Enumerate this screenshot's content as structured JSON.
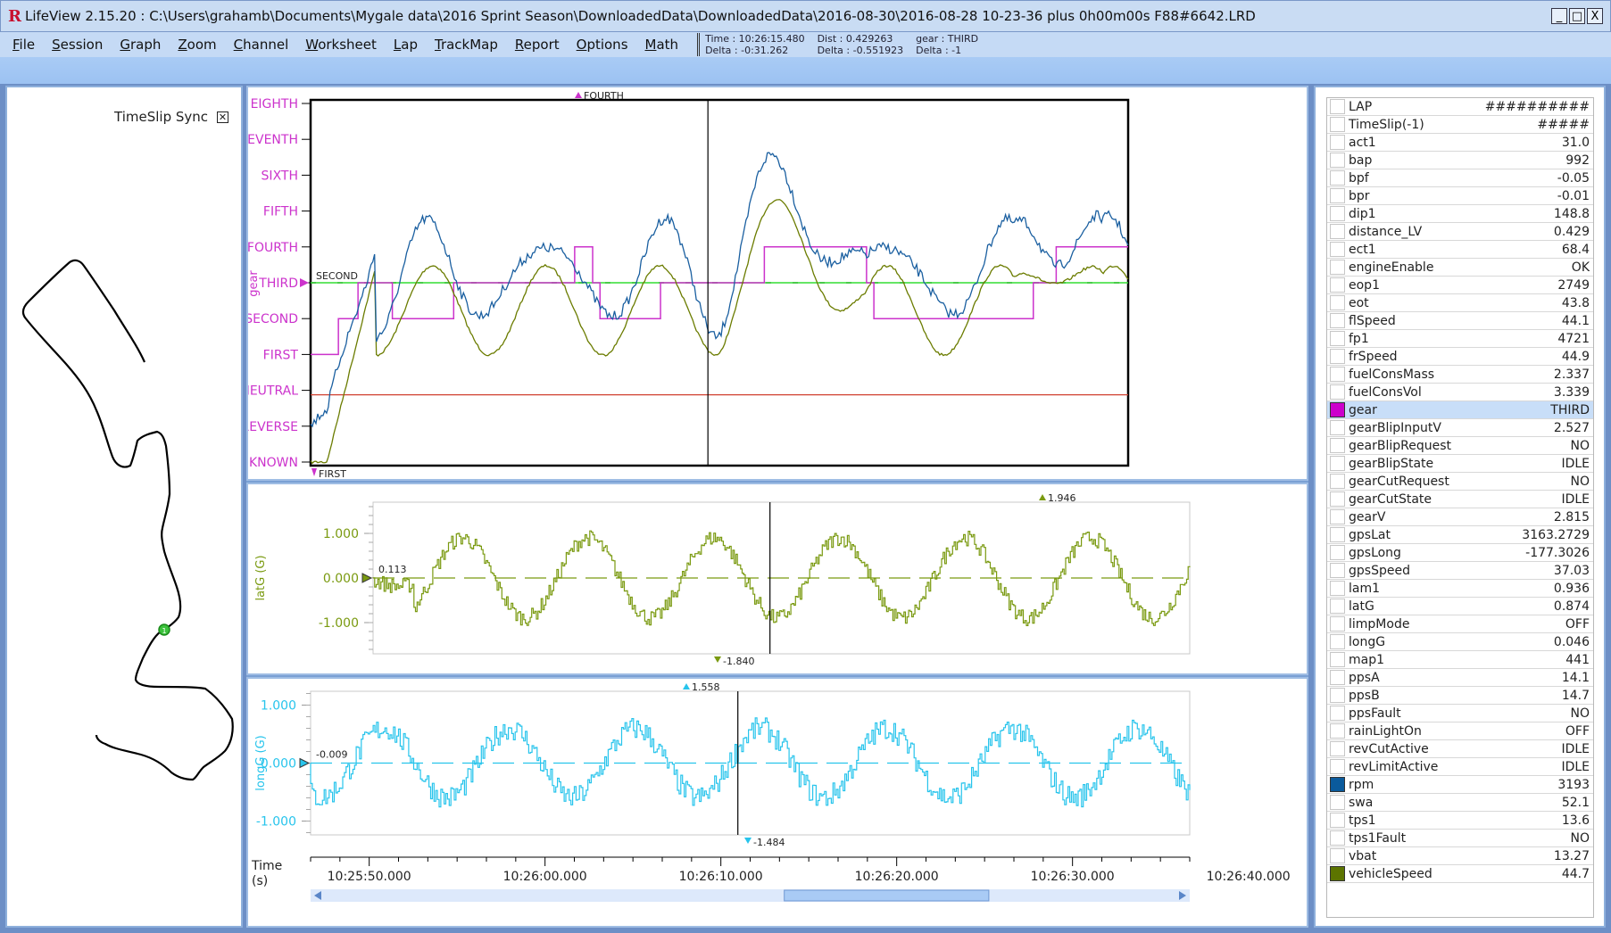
{
  "window": {
    "app": "LifeView 2.15.20",
    "title": "LifeView 2.15.20  :  C:\\Users\\grahamb\\Documents\\Mygale data\\2016 Sprint Season\\DownloadedData\\DownloadedData\\2016-08-30\\2016-08-28 10-23-36 plus 0h00m00s F88#6642.LRD",
    "minimize": "_",
    "maximize": "□",
    "close": "X"
  },
  "menu": [
    "File",
    "Session",
    "Graph",
    "Zoom",
    "Channel",
    "Worksheet",
    "Lap",
    "TrackMap",
    "Report",
    "Options",
    "Math"
  ],
  "readout": {
    "time": "Time : 10:26:15.480",
    "time_delta": "Delta : -0:31.262",
    "dist": "Dist : 0.429263",
    "dist_delta": "Delta : -0.551923",
    "gear": "gear : THIRD",
    "gear_delta": "Delta : -1"
  },
  "trackmap": {
    "timeslip_label": "TimeSlip Sync",
    "timeslip_checked": true,
    "marker_label": "1",
    "marker_color": "#3cc23c"
  },
  "colors": {
    "gear": "#cc33cc",
    "rpm": "#1a5fa0",
    "vehicleSpeed": "#6b7c00",
    "latG": "#7a9a10",
    "longG": "#27c4ec",
    "neutral_line": "#d04030",
    "ref_line": "#33dd33"
  },
  "graphs": {
    "gear": {
      "axis_label": "gear",
      "ticks": [
        "EIGHTH",
        "SEVENTH",
        "SIXTH",
        "FIFTH",
        "FOURTH",
        "THIRD",
        "SECOND",
        "FIRST",
        "NEUTRAL",
        "REVERSE",
        "UNKNOWN"
      ],
      "max_marker": "FOURTH",
      "min_marker": "FIRST",
      "cursor_label": "SECOND"
    },
    "latG": {
      "axis_label": "latG (G)",
      "ticks": [
        "1.000",
        "0.000",
        "-1.000"
      ],
      "max_marker": "1.946",
      "min_marker": "-1.840",
      "cursor_value": "0.113"
    },
    "longG": {
      "axis_label": "longG (G)",
      "ticks": [
        "1.000",
        "0.000",
        "-1.000"
      ],
      "max_marker": "1.558",
      "min_marker": "-1.484",
      "cursor_value": "-0.009"
    },
    "time_axis": {
      "label": "Time\n(s)",
      "ticks": [
        "10:25:50.000",
        "10:26:00.000",
        "10:26:10.000",
        "10:26:20.000",
        "10:26:30.000",
        "10:26:40.000"
      ],
      "scroll_position": 0.54,
      "scroll_size": 0.24
    }
  },
  "channels": [
    {
      "name": "LAP",
      "value": "##########",
      "color": null
    },
    {
      "name": "TimeSlip(-1)",
      "value": "#####",
      "color": null
    },
    {
      "name": "act1",
      "value": "31.0",
      "color": null
    },
    {
      "name": "bap",
      "value": "992",
      "color": null
    },
    {
      "name": "bpf",
      "value": "-0.05",
      "color": null
    },
    {
      "name": "bpr",
      "value": "-0.01",
      "color": null
    },
    {
      "name": "dip1",
      "value": "148.8",
      "color": null
    },
    {
      "name": "distance_LV",
      "value": "0.429",
      "color": null
    },
    {
      "name": "ect1",
      "value": "68.4",
      "color": null
    },
    {
      "name": "engineEnable",
      "value": "OK",
      "color": null
    },
    {
      "name": "eop1",
      "value": "2749",
      "color": null
    },
    {
      "name": "eot",
      "value": "43.8",
      "color": null
    },
    {
      "name": "flSpeed",
      "value": "44.1",
      "color": null
    },
    {
      "name": "fp1",
      "value": "4721",
      "color": null
    },
    {
      "name": "frSpeed",
      "value": "44.9",
      "color": null
    },
    {
      "name": "fuelConsMass",
      "value": "2.337",
      "color": null
    },
    {
      "name": "fuelConsVol",
      "value": "3.339",
      "color": null
    },
    {
      "name": "gear",
      "value": "THIRD",
      "color": "#cc00cc",
      "selected": true
    },
    {
      "name": "gearBlipInputV",
      "value": "2.527",
      "color": null
    },
    {
      "name": "gearBlipRequest",
      "value": "NO",
      "color": null
    },
    {
      "name": "gearBlipState",
      "value": "IDLE",
      "color": null
    },
    {
      "name": "gearCutRequest",
      "value": "NO",
      "color": null
    },
    {
      "name": "gearCutState",
      "value": "IDLE",
      "color": null
    },
    {
      "name": "gearV",
      "value": "2.815",
      "color": null
    },
    {
      "name": "gpsLat",
      "value": "3163.2729",
      "color": null
    },
    {
      "name": "gpsLong",
      "value": "-177.3026",
      "color": null
    },
    {
      "name": "gpsSpeed",
      "value": "37.03",
      "color": null
    },
    {
      "name": "lam1",
      "value": "0.936",
      "color": null
    },
    {
      "name": "latG",
      "value": "0.874",
      "color": null
    },
    {
      "name": "limpMode",
      "value": "OFF",
      "color": null
    },
    {
      "name": "longG",
      "value": "0.046",
      "color": null
    },
    {
      "name": "map1",
      "value": "441",
      "color": null
    },
    {
      "name": "ppsA",
      "value": "14.1",
      "color": null
    },
    {
      "name": "ppsB",
      "value": "14.7",
      "color": null
    },
    {
      "name": "ppsFault",
      "value": "NO",
      "color": null
    },
    {
      "name": "rainLightOn",
      "value": "OFF",
      "color": null
    },
    {
      "name": "revCutActive",
      "value": "IDLE",
      "color": null
    },
    {
      "name": "revLimitActive",
      "value": "IDLE",
      "color": null
    },
    {
      "name": "rpm",
      "value": "3193",
      "color": "#0a5a9c"
    },
    {
      "name": "swa",
      "value": "52.1",
      "color": null
    },
    {
      "name": "tps1",
      "value": "13.6",
      "color": null
    },
    {
      "name": "tps1Fault",
      "value": "NO",
      "color": null
    },
    {
      "name": "vbat",
      "value": "13.27",
      "color": null
    },
    {
      "name": "vehicleSpeed",
      "value": "44.7",
      "color": "#5c7400"
    }
  ]
}
